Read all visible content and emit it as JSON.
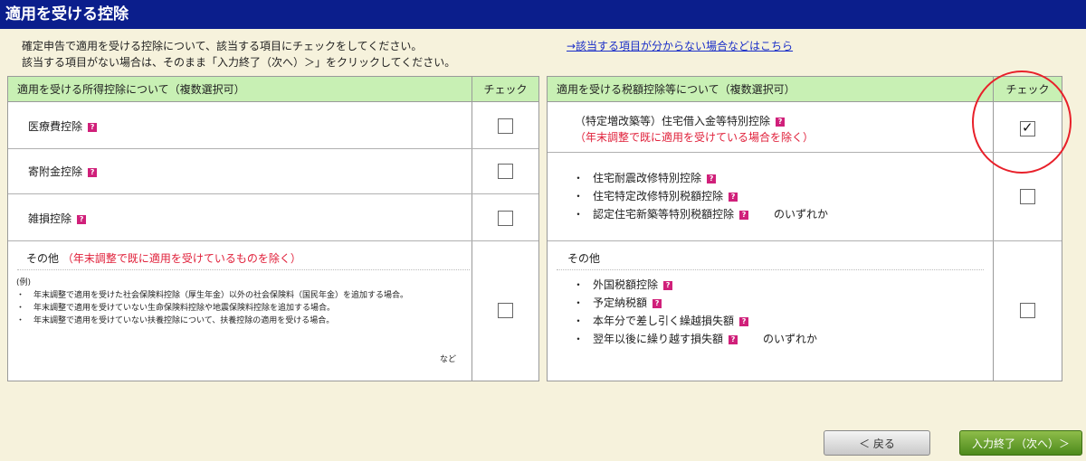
{
  "window": {
    "title": "適用を受ける控除"
  },
  "intro": {
    "line1": "確定申告で適用を受ける控除について、該当する項目にチェックをしてください。",
    "line2": "該当する項目がない場合は、そのまま「入力終了（次へ）＞」をクリックしてください。",
    "help_link": "→該当する項目が分からない場合などはこちら"
  },
  "left_panel": {
    "header": "適用を受ける所得控除について（複数選択可）",
    "check_header": "チェック",
    "rows": [
      {
        "label": "医療費控除",
        "checked": false
      },
      {
        "label": "寄附金控除",
        "checked": false
      },
      {
        "label": "雑損控除",
        "checked": false
      }
    ],
    "other": {
      "label": "その他",
      "note": "（年末調整で既に適用を受けているものを除く）",
      "example_title": "(例)",
      "examples": [
        "年末調整で適用を受けた社会保険料控除（厚生年金）以外の社会保険料（国民年金）を追加する場合。",
        "年末調整で適用を受けていない生命保険料控除や地震保険料控除を追加する場合。",
        "年末調整で適用を受けていない扶養控除について、扶養控除の適用を受ける場合。"
      ],
      "etc": "など",
      "checked": false
    }
  },
  "right_panel": {
    "header": "適用を受ける税額控除等について（複数選択可）",
    "check_header": "チェック",
    "housing_loan": {
      "label": "（特定増改築等）住宅借入金等特別控除",
      "note": "（年末調整で既に適用を受けている場合を除く）",
      "checked": true
    },
    "renovation": {
      "items": [
        "住宅耐震改修特別控除",
        "住宅特定改修特別税額控除",
        "認定住宅新築等特別税額控除"
      ],
      "suffix": "のいずれか",
      "checked": false
    },
    "other": {
      "label": "その他",
      "items": [
        "外国税額控除",
        "予定納税額",
        "本年分で差し引く繰越損失額",
        "翌年以後に繰り越す損失額"
      ],
      "suffix": "のいずれか",
      "checked": false
    }
  },
  "buttons": {
    "back": "＜ 戻る",
    "next": "入力終了（次へ）＞"
  },
  "help_icon_glyph": "?",
  "colors": {
    "title_bar": "#0b1e8c",
    "header_bg": "#c8f0b4",
    "accent_red": "#e0203a",
    "next_button": "#5a9a24"
  }
}
